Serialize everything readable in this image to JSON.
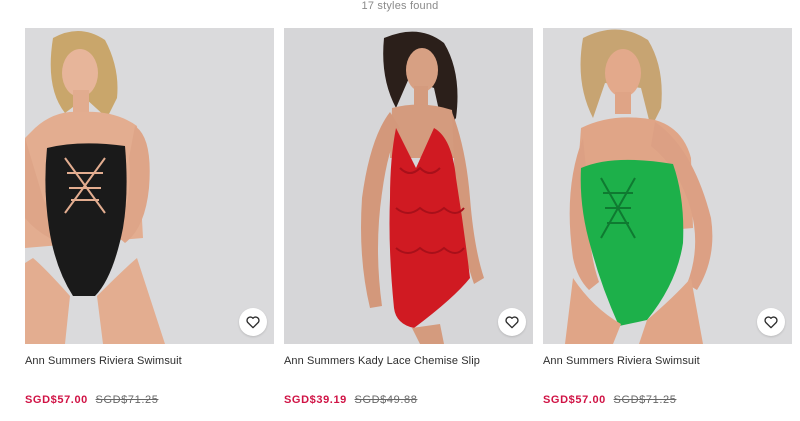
{
  "results": {
    "count_text": "17 styles found"
  },
  "colors": {
    "sale_price": "#d01345",
    "was_price": "#666666",
    "card_background": "#d8d8da"
  },
  "products": [
    {
      "title": "Ann Summers Riviera Swimsuit",
      "price_now": "SGD$57.00",
      "price_was": "SGD$71.25",
      "garment_color": "#1a1a1a",
      "save_icon": "heart-outline-icon"
    },
    {
      "title": "Ann Summers Kady Lace Chemise Slip",
      "price_now": "SGD$39.19",
      "price_was": "SGD$49.88",
      "garment_color": "#d01a22",
      "save_icon": "heart-outline-icon"
    },
    {
      "title": "Ann Summers Riviera Swimsuit",
      "price_now": "SGD$57.00",
      "price_was": "SGD$71.25",
      "garment_color": "#1db04a",
      "save_icon": "heart-outline-icon"
    }
  ]
}
